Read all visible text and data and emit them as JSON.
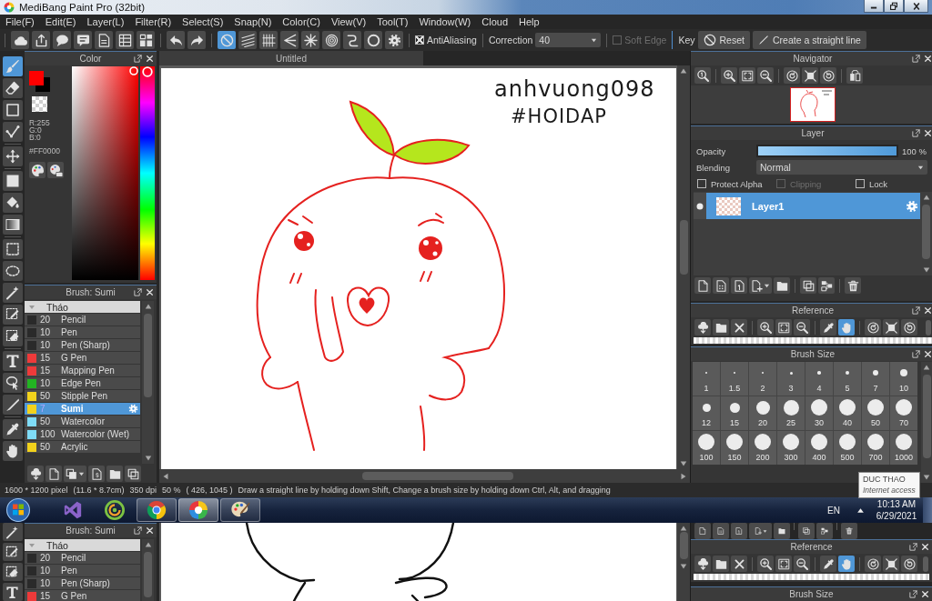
{
  "window": {
    "title": "MediBang Paint Pro (32bit)"
  },
  "menu": [
    "File(F)",
    "Edit(E)",
    "Layer(L)",
    "Filter(R)",
    "Select(S)",
    "Snap(N)",
    "Color(C)",
    "View(V)",
    "Tool(T)",
    "Window(W)",
    "Cloud",
    "Help"
  ],
  "toolbar": {
    "file_tools": [
      {
        "kind": "cloud"
      },
      {
        "kind": "upload"
      },
      {
        "kind": "speech"
      },
      {
        "kind": "comment"
      },
      {
        "kind": "document"
      },
      {
        "kind": "list"
      },
      {
        "kind": "tiles"
      }
    ],
    "history": [
      {
        "kind": "undo"
      },
      {
        "kind": "redo"
      }
    ],
    "snaps": [
      {
        "kind": "none",
        "selected": true
      },
      {
        "kind": "parallel",
        "selected": false
      },
      {
        "kind": "grid",
        "selected": false
      },
      {
        "kind": "vanishing",
        "selected": false
      },
      {
        "kind": "radial",
        "selected": false
      },
      {
        "kind": "concentric",
        "selected": false
      },
      {
        "kind": "curve",
        "selected": false
      },
      {
        "kind": "circle",
        "selected": false
      },
      {
        "kind": "settings",
        "selected": false
      }
    ],
    "antialiasing": {
      "label": "AntiAliasing",
      "checked": true
    },
    "correction": {
      "label": "Correction",
      "value": "40"
    },
    "soft_edge": {
      "label": "Soft Edge",
      "checked": false,
      "disabled": true
    },
    "key_label": "Key",
    "reset_button": "Reset",
    "straight_line_button": "Create a straight line"
  },
  "tool_groups": [
    [
      {
        "kind": "brush",
        "selected": true
      },
      {
        "kind": "eraser",
        "selected": false
      },
      {
        "kind": "rectangle",
        "selected": false
      },
      {
        "kind": "polyline",
        "selected": false
      }
    ],
    [
      {
        "kind": "move",
        "selected": false
      }
    ],
    [
      {
        "kind": "fill",
        "selected": false
      },
      {
        "kind": "bucket",
        "selected": false
      },
      {
        "kind": "gradient",
        "selected": false
      }
    ],
    [
      {
        "kind": "select",
        "selected": false
      },
      {
        "kind": "lasso",
        "selected": false
      },
      {
        "kind": "wand",
        "selected": false
      },
      {
        "kind": "select-pen",
        "selected": false
      },
      {
        "kind": "select-eraser",
        "selected": false
      }
    ],
    [
      {
        "kind": "text",
        "selected": false
      },
      {
        "kind": "operation",
        "selected": false
      },
      {
        "kind": "knife",
        "selected": false
      }
    ],
    [
      {
        "kind": "dropper",
        "selected": false
      },
      {
        "kind": "hand",
        "selected": false
      }
    ]
  ],
  "color_panel": {
    "title": "Color",
    "swatches": [
      {
        "kind": "foreground",
        "color": "#ff0000"
      },
      {
        "kind": "background",
        "color": "#000000"
      },
      {
        "kind": "transparent"
      }
    ],
    "channels": [
      "R:255",
      "G:0",
      "B:0"
    ],
    "hex": "#FF0000",
    "hue_slider": {
      "level": 0
    },
    "buttons": [
      {
        "kind": "palette"
      },
      {
        "kind": "picker"
      }
    ]
  },
  "brush_panel": {
    "title": "Brush: Sumi",
    "group": {
      "label": "Tháo",
      "expanded": true
    },
    "brushes": [
      {
        "size": "20",
        "name": "Pencil",
        "color": "#2a2a2a",
        "selected": false
      },
      {
        "size": "10",
        "name": "Pen",
        "color": "#2a2a2a",
        "selected": false
      },
      {
        "size": "10",
        "name": "Pen (Sharp)",
        "color": "#2a2a2a",
        "selected": false
      },
      {
        "size": "15",
        "name": "G Pen",
        "color": "#ee3a3a",
        "selected": false
      },
      {
        "size": "15",
        "name": "Mapping Pen",
        "color": "#ee3a3a",
        "selected": false
      },
      {
        "size": "10",
        "name": "Edge Pen",
        "color": "#22b422",
        "selected": false
      },
      {
        "size": "50",
        "name": "Stipple Pen",
        "color": "#f2d21c",
        "selected": false
      },
      {
        "size": "7",
        "name": "Sumi",
        "color": "#f2d21c",
        "selected": true
      },
      {
        "size": "50",
        "name": "Watercolor",
        "color": "#7fdcf7",
        "selected": false
      },
      {
        "size": "100",
        "name": "Watercolor (Wet)",
        "color": "#7fdcf7",
        "selected": false
      },
      {
        "size": "50",
        "name": "Acrylic",
        "color": "#f2d21c",
        "selected": false
      }
    ],
    "buttons": [
      {
        "kind": "cloud-download"
      },
      {
        "kind": "new"
      },
      {
        "kind": "copy-menu"
      },
      {
        "kind": "script"
      },
      {
        "kind": "folder"
      },
      {
        "kind": "duplicate"
      }
    ]
  },
  "canvas": {
    "tab": "Untitled",
    "signature": [
      "anhvuong098",
      "#HOIDAP"
    ]
  },
  "navigator": {
    "title": "Navigator",
    "tool_groups": [
      [
        {
          "kind": "zoom-reset"
        }
      ],
      [
        {
          "kind": "zoom-in"
        },
        {
          "kind": "fit"
        },
        {
          "kind": "zoom-out"
        }
      ],
      [
        {
          "kind": "rotate-left"
        },
        {
          "kind": "fit-screen"
        },
        {
          "kind": "rotate-right"
        }
      ],
      [
        {
          "kind": "flip"
        }
      ]
    ]
  },
  "layer_panel": {
    "title": "Layer",
    "opacity": {
      "label": "Opacity",
      "level": 1,
      "reading": "100 %"
    },
    "blending": {
      "label": "Blending",
      "value": "Normal"
    },
    "options": [
      {
        "label": "Protect Alpha",
        "checked": false,
        "disabled": false
      },
      {
        "label": "Clipping",
        "checked": false,
        "disabled": true
      },
      {
        "label": "Lock",
        "checked": false,
        "disabled": false
      }
    ],
    "layers": [
      {
        "name": "Layer1",
        "visible": true,
        "selected": true
      }
    ],
    "tool_groups": [
      [
        {
          "kind": "new"
        },
        {
          "kind": "halftone"
        },
        {
          "kind": "onebit"
        },
        {
          "kind": "add-layer-menu"
        },
        {
          "kind": "folder"
        }
      ],
      [
        {
          "kind": "duplicate"
        },
        {
          "kind": "merge"
        }
      ],
      [
        {
          "kind": "trash"
        }
      ]
    ]
  },
  "reference": {
    "title": "Reference",
    "tool_groups": [
      [
        {
          "kind": "cloud-download",
          "selected": false
        },
        {
          "kind": "folder",
          "selected": false
        },
        {
          "kind": "close",
          "selected": false
        }
      ],
      [
        {
          "kind": "zoom-in",
          "selected": false
        },
        {
          "kind": "fit",
          "selected": false
        },
        {
          "kind": "zoom-out",
          "selected": false
        }
      ],
      [
        {
          "kind": "dropper",
          "selected": false
        },
        {
          "kind": "hand",
          "selected": true
        }
      ],
      [
        {
          "kind": "rotate-left",
          "selected": false
        },
        {
          "kind": "fit-screen",
          "selected": false
        },
        {
          "kind": "rotate-right",
          "selected": false
        }
      ]
    ]
  },
  "brush_size": {
    "title": "Brush Size",
    "sizes": [
      "1",
      "1.5",
      "2",
      "3",
      "4",
      "5",
      "7",
      "10",
      "12",
      "15",
      "20",
      "25",
      "30",
      "40",
      "50",
      "70",
      "100",
      "150",
      "200",
      "300",
      "400",
      "500",
      "700",
      "1000"
    ]
  },
  "tooltip": {
    "title": "DUC THAO",
    "text": "Internet access"
  },
  "status_bar": {
    "image_size": "1600 * 1200 pixel",
    "physical_size": "(11.6 * 8.7cm)",
    "resolution": "350 dpi",
    "zoom": "50 %",
    "position": "( 426, 1045 )",
    "hint": "Draw a straight line by holding down Shift, Change a brush size by holding down Ctrl, Alt, and dragging"
  },
  "taskbar": {
    "apps": [
      {
        "kind": "visual-studio",
        "running": false,
        "selected": false
      },
      {
        "kind": "coccoc",
        "running": false,
        "selected": false
      },
      {
        "kind": "chrome",
        "running": true,
        "selected": false
      },
      {
        "kind": "medibang",
        "running": true,
        "selected": true
      },
      {
        "kind": "paint",
        "running": true,
        "selected": false
      }
    ],
    "language": "EN",
    "time": "10:13 AM",
    "date": "6/29/2021"
  },
  "lower_window": {
    "tools": [
      {
        "kind": "wand"
      },
      {
        "kind": "select-pen"
      },
      {
        "kind": "select-eraser"
      },
      {
        "kind": "text"
      }
    ],
    "brush_panel": {
      "title": "Brush: Sumi",
      "group": {
        "label": "Tháo",
        "expanded": true
      },
      "brushes": [
        {
          "size": "20",
          "name": "Pencil",
          "color": "#2a2a2a"
        },
        {
          "size": "10",
          "name": "Pen",
          "color": "#2a2a2a"
        },
        {
          "size": "10",
          "name": "Pen (Sharp)",
          "color": "#2a2a2a"
        },
        {
          "size": "15",
          "name": "G Pen",
          "color": "#ee3a3a"
        }
      ]
    },
    "layer_tool_groups": [
      [
        {
          "kind": "new"
        },
        {
          "kind": "halftone"
        },
        {
          "kind": "onebit"
        },
        {
          "kind": "add-layer-menu"
        },
        {
          "kind": "folder"
        }
      ],
      [
        {
          "kind": "duplicate"
        },
        {
          "kind": "merge"
        }
      ],
      [
        {
          "kind": "trash"
        }
      ]
    ],
    "reference": {
      "title": "Reference",
      "tool_groups": [
        [
          {
            "kind": "cloud-download",
            "selected": false
          },
          {
            "kind": "folder",
            "selected": false
          },
          {
            "kind": "close",
            "selected": false
          }
        ],
        [
          {
            "kind": "zoom-in",
            "selected": false
          },
          {
            "kind": "fit",
            "selected": false
          },
          {
            "kind": "zoom-out",
            "selected": false
          }
        ],
        [
          {
            "kind": "dropper",
            "selected": false
          },
          {
            "kind": "hand",
            "selected": true
          }
        ],
        [
          {
            "kind": "rotate-left",
            "selected": false
          },
          {
            "kind": "fit-screen",
            "selected": false
          },
          {
            "kind": "rotate-right",
            "selected": false
          }
        ]
      ]
    },
    "brush_size": {
      "title": "Brush Size"
    }
  }
}
